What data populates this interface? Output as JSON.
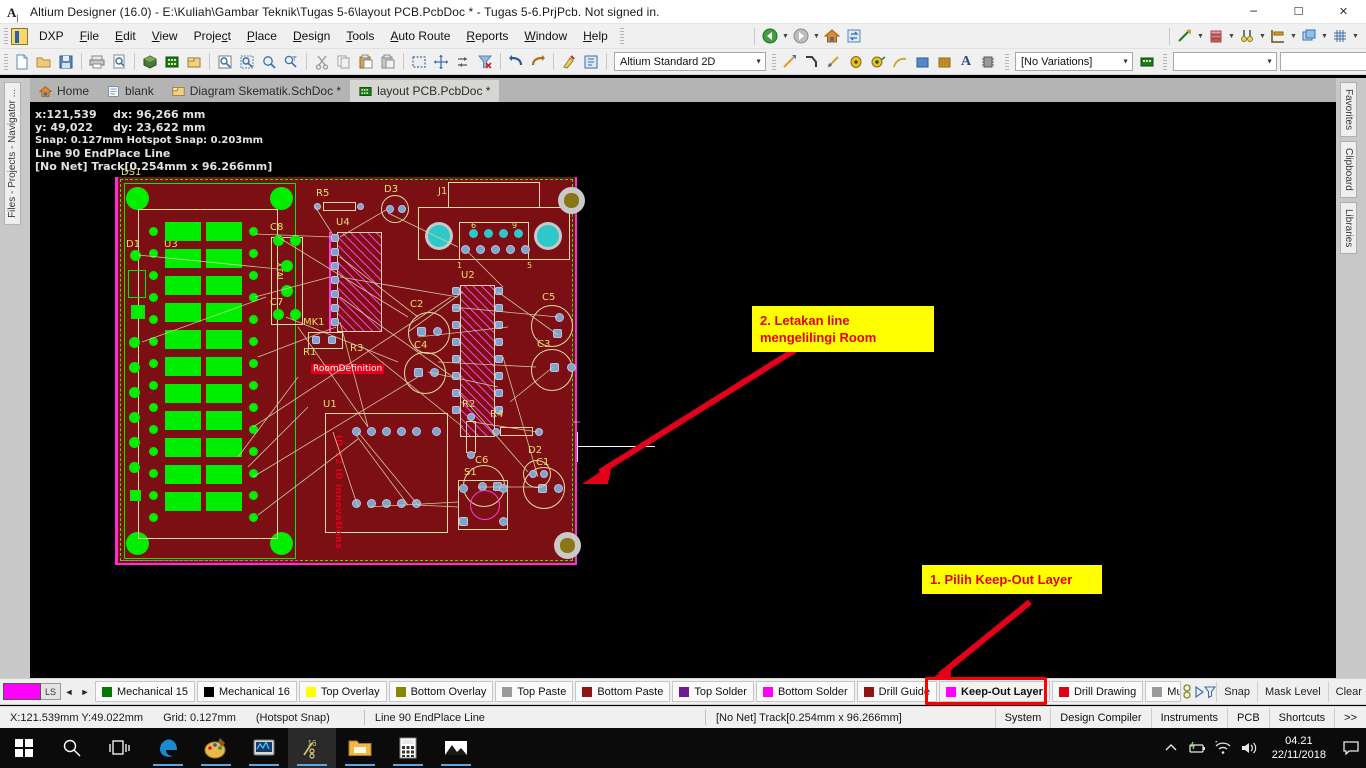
{
  "window": {
    "title": "Altium Designer (16.0) - E:\\Kuliah\\Gambar Teknik\\Tugas 5-6\\layout PCB.PcbDoc * - Tugas 5-6.PrjPcb. Not signed in.",
    "app_icon": "altium-icon",
    "minimize": "─",
    "maximize": "☐",
    "close": "✕"
  },
  "menubar": {
    "dxp_label": "DXP",
    "items": [
      {
        "label": "File",
        "accel": "F"
      },
      {
        "label": "Edit",
        "accel": "E"
      },
      {
        "label": "View",
        "accel": "V"
      },
      {
        "label": "Project",
        "accel": "c"
      },
      {
        "label": "Place",
        "accel": "P"
      },
      {
        "label": "Design",
        "accel": "D"
      },
      {
        "label": "Tools",
        "accel": "T"
      },
      {
        "label": "Auto Route",
        "accel": "A"
      },
      {
        "label": "Reports",
        "accel": "R"
      },
      {
        "label": "Window",
        "accel": "W"
      },
      {
        "label": "Help",
        "accel": "H"
      }
    ],
    "right_icons": [
      "measure-icon",
      "layers-stack-icon",
      "find-similar-icon",
      "board-insight-icon",
      "layer-sets-icon",
      "grid-icon"
    ]
  },
  "toolbar": {
    "file_icons": [
      "new-document-icon",
      "open-folder-icon",
      "save-icon"
    ],
    "print_icons": [
      "print-icon",
      "print-preview-icon"
    ],
    "view3d_icons": [
      "view-3d-icon",
      "pcb-document-icon",
      "library-icon"
    ],
    "zoom_icons": [
      "zoom-fit-icon",
      "zoom-area-icon",
      "zoom-in-icon",
      "zoom-filter-icon"
    ],
    "clipboard_icons": [
      "cut-icon",
      "copy-icon",
      "paste-icon",
      "paste-special-icon"
    ],
    "select_icons": [
      "select-area-icon",
      "move-icon",
      "swap-icon",
      "clear-filter-icon"
    ],
    "undo_icons": [
      "undo-icon",
      "redo-icon"
    ],
    "misc_icons": [
      "highlight-icon",
      "inspector-icon"
    ],
    "nav_icons": [
      "back-icon",
      "forward-icon",
      "home-icon",
      "refresh-icon"
    ],
    "view_config": "Altium Standard 2D",
    "place_icons": [
      "place-line-icon",
      "place-track-icon",
      "place-arc-icon",
      "place-pad-icon",
      "place-via-icon",
      "place-arc-center-icon",
      "place-fill-icon",
      "place-polygon-icon",
      "place-string-icon",
      "place-component-icon"
    ],
    "variations": "[No Variations]",
    "variant_icon": "variant-board-icon",
    "blank_combo_1": "",
    "blank_combo_2": ""
  },
  "left_panels": [
    "Files - Projects - Navigator ..."
  ],
  "right_panels": [
    "Favorites",
    "Clipboard",
    "Libraries"
  ],
  "doc_tabs": [
    {
      "label": "Home",
      "icon": "home-icon",
      "active": false
    },
    {
      "label": "blank",
      "icon": "blank-doc-icon",
      "active": false
    },
    {
      "label": "Diagram Skematik.SchDoc *",
      "icon": "schematic-icon",
      "active": false
    },
    {
      "label": "layout PCB.PcbDoc *",
      "icon": "pcb-icon",
      "active": true
    }
  ],
  "hud": {
    "x_label": "x:121,539",
    "dx_label": "dx: 96,266 mm",
    "y_label": "y: 49,022",
    "dy_label": "dy: 23,622 mm",
    "snap": "Snap: 0.127mm Hotspot Snap: 0.203mm",
    "command": "Line 90 EndPlace Line",
    "object": "[No Net] Track[0.254mm x 96.266mm]"
  },
  "board": {
    "room_definition_label": "RoomDefinition",
    "silkscreen_text": "ID-12 ID Innovations",
    "designators": [
      "DS1",
      "D1",
      "U3",
      "R5",
      "D3",
      "J1",
      "U4",
      "C8",
      "C7",
      "MK1",
      "R1",
      "R3",
      "U2",
      "C2",
      "C4",
      "C5",
      "C3",
      "C6",
      "C1",
      "U1",
      "R2",
      "R4",
      "D2",
      "S1",
      "6",
      "9",
      "1",
      "5"
    ]
  },
  "callouts": [
    {
      "id": "callout-2",
      "text": "2. Letakan line\nmengelilingi Room"
    },
    {
      "id": "callout-1",
      "text": "1. Pilih Keep-Out Layer"
    }
  ],
  "layerbar": {
    "active_color": "#ff00ff",
    "ls_label": "LS",
    "prev_icon": "◄",
    "next_icon": "►",
    "layers": [
      {
        "label": "Mechanical 15",
        "color": "#007a00",
        "selected": false
      },
      {
        "label": "Mechanical 16",
        "color": "#000000",
        "selected": false
      },
      {
        "label": "Top Overlay",
        "color": "#ffff00",
        "selected": false
      },
      {
        "label": "Bottom Overlay",
        "color": "#878700",
        "selected": false
      },
      {
        "label": "Top Paste",
        "color": "#9a9a9a",
        "selected": false
      },
      {
        "label": "Bottom Paste",
        "color": "#8f1414",
        "selected": false
      },
      {
        "label": "Top Solder",
        "color": "#6b1b8f",
        "selected": false
      },
      {
        "label": "Bottom Solder",
        "color": "#ff00ff",
        "selected": false
      },
      {
        "label": "Drill Guide",
        "color": "#8f1414",
        "selected": false
      },
      {
        "label": "Keep-Out Layer",
        "color": "#ff00ff",
        "selected": true
      },
      {
        "label": "Drill Drawing",
        "color": "#e2001a",
        "selected": false
      },
      {
        "label": "Mu",
        "color": "#9a9a9a",
        "selected": false
      }
    ],
    "tools": [
      "Snap",
      "Mask Level",
      "Clear"
    ],
    "layer_tool_icons": [
      "layer-toggle-icon",
      "layer-play-icon",
      "layer-filter-icon"
    ]
  },
  "statusbar": {
    "coords": "X:121.539mm Y:49.022mm",
    "grid": "Grid: 0.127mm",
    "snap_mode": "(Hotspot Snap)",
    "command": "Line 90 EndPlace Line",
    "object": "[No Net] Track[0.254mm x 96.266mm]",
    "panels": [
      "System",
      "Design Compiler",
      "Instruments",
      "PCB",
      "Shortcuts"
    ],
    "more": ">>"
  },
  "taskbar": {
    "start_icon": "windows-start-icon",
    "search_icon": "search-icon",
    "taskview_icon": "task-view-icon",
    "apps": [
      {
        "name": "edge-icon",
        "glyph": "e",
        "active": false,
        "running": true
      },
      {
        "name": "paint-icon",
        "glyph": "🎨",
        "active": false,
        "running": true
      },
      {
        "name": "multisim-icon",
        "glyph": "📊",
        "active": false,
        "running": true
      },
      {
        "name": "altium-icon",
        "glyph": "16",
        "active": true,
        "running": true
      },
      {
        "name": "file-explorer-icon",
        "glyph": "📁",
        "active": false,
        "running": true
      },
      {
        "name": "calculator-icon",
        "glyph": "🖫",
        "active": false,
        "running": true
      },
      {
        "name": "photos-icon",
        "glyph": "🖼",
        "active": false,
        "running": true
      }
    ],
    "tray_icons": [
      "show-hidden-icons-chevron",
      "battery-icon",
      "wifi-icon",
      "volume-icon"
    ],
    "clock_time": "04.21",
    "clock_date": "22/11/2018",
    "notification_icon": "action-center-icon"
  }
}
